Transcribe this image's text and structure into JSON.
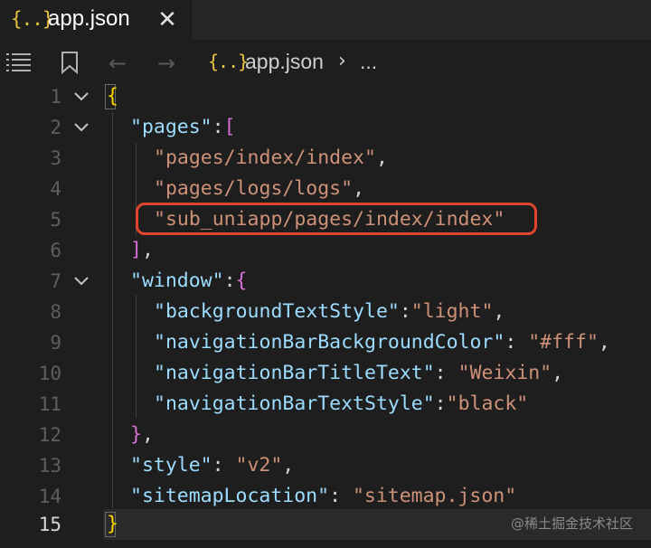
{
  "tab": {
    "icon": "{..}",
    "title": "app.json",
    "close": "✕"
  },
  "breadcrumbs": {
    "icon": "{..}",
    "file": "app.json",
    "separator": "›",
    "more": "..."
  },
  "lines": [
    {
      "n": "1",
      "fold": true
    },
    {
      "n": "2",
      "fold": true
    },
    {
      "n": "3"
    },
    {
      "n": "4"
    },
    {
      "n": "5"
    },
    {
      "n": "6"
    },
    {
      "n": "7",
      "fold": true
    },
    {
      "n": "8"
    },
    {
      "n": "9"
    },
    {
      "n": "10"
    },
    {
      "n": "11"
    },
    {
      "n": "12"
    },
    {
      "n": "13"
    },
    {
      "n": "14"
    },
    {
      "n": "15",
      "active": true
    }
  ],
  "code": {
    "l1_open": "{",
    "l2_key": "\"pages\"",
    "l2_colon": ":",
    "l2_bracket": "[",
    "l3_val": "\"pages/index/index\"",
    "l3_comma": ",",
    "l4_val": "\"pages/logs/logs\"",
    "l4_comma": ",",
    "l5_val": "\"sub_uniapp/pages/index/index\"",
    "l6_bracket": "]",
    "l6_comma": ",",
    "l7_key": "\"window\"",
    "l7_colon": ":",
    "l7_brace": "{",
    "l8_key": "\"backgroundTextStyle\"",
    "l8_colon": ":",
    "l8_val": "\"light\"",
    "l8_comma": ",",
    "l9_key": "\"navigationBarBackgroundColor\"",
    "l9_colon": ": ",
    "l9_val": "\"#fff\"",
    "l9_comma": ",",
    "l10_key": "\"navigationBarTitleText\"",
    "l10_colon": ": ",
    "l10_val": "\"Weixin\"",
    "l10_comma": ",",
    "l11_key": "\"navigationBarTextStyle\"",
    "l11_colon": ":",
    "l11_val": "\"black\"",
    "l12_brace": "}",
    "l12_comma": ",",
    "l13_key": "\"style\"",
    "l13_colon": ": ",
    "l13_val": "\"v2\"",
    "l13_comma": ",",
    "l14_key": "\"sitemapLocation\"",
    "l14_colon": ": ",
    "l14_val": "\"sitemap.json\"",
    "l15_close": "}"
  },
  "watermark": "@稀土掘金技术社区",
  "colors": {
    "background": "#1e1e1e",
    "key": "#9cdcfe",
    "string": "#ce9178",
    "bracket_gold": "#ffd700",
    "bracket_purple": "#da70d6",
    "highlight_border": "#e0442c"
  },
  "icons": {
    "tab_icon": "json-braces-icon",
    "list": "outline-list-icon",
    "bookmark": "bookmark-icon",
    "back": "arrow-left-icon",
    "forward": "arrow-right-icon",
    "fold": "chevron-down-icon"
  }
}
